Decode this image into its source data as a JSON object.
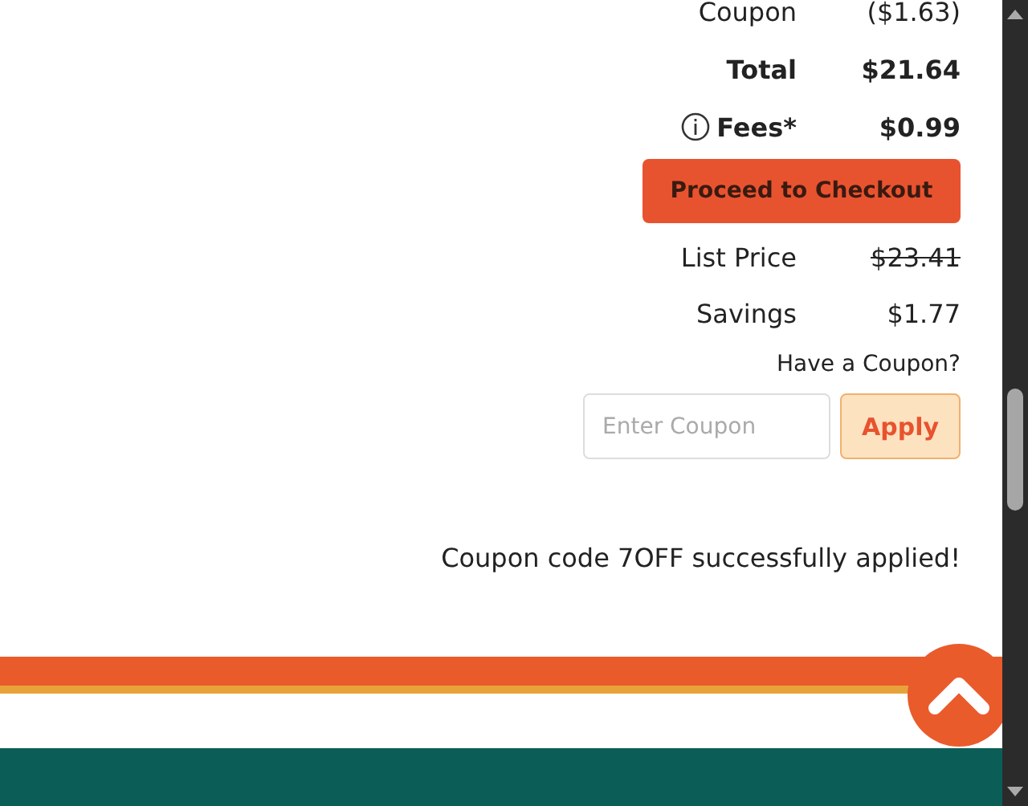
{
  "summary_rows": [
    {
      "label": "Coupon",
      "value": "($1.63)",
      "kind": "plain",
      "info": false,
      "strike": false
    },
    {
      "label": "Total",
      "value": "$21.64",
      "kind": "bold",
      "info": false,
      "strike": false
    },
    {
      "label": "Fees*",
      "value": "$0.99",
      "kind": "bold",
      "info": true,
      "strike": false
    }
  ],
  "checkout_button": "Proceed to Checkout",
  "price_rows": [
    {
      "label": "List Price",
      "value": "$23.41",
      "strike": true
    },
    {
      "label": "Savings",
      "value": "$1.77",
      "strike": false
    }
  ],
  "coupon": {
    "prompt": "Have a Coupon?",
    "placeholder": "Enter Coupon",
    "button": "Apply",
    "message": "Coupon code 7OFF successfully applied!"
  }
}
